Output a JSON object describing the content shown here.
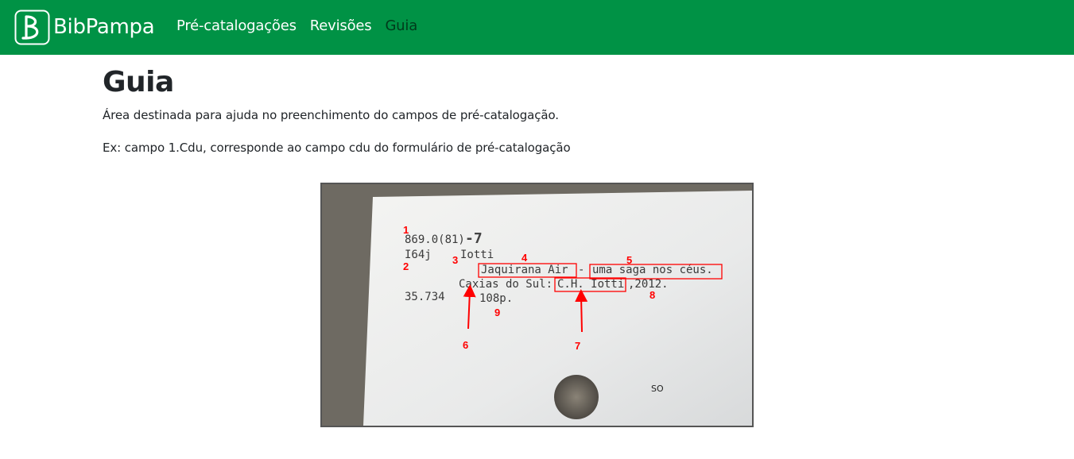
{
  "navbar": {
    "brand": "BibPampa",
    "links": [
      {
        "label": "Pré-catalogações"
      },
      {
        "label": "Revisões"
      },
      {
        "label": "Guia"
      }
    ],
    "colors": {
      "background": "#009245",
      "active_link": "#4d4d4d"
    }
  },
  "page": {
    "title": "Guia",
    "description": "Área destinada para ajuda no preenchimento do campos de pré-catalogação.",
    "example": "Ex: campo 1.Cdu, corresponde ao campo cdu do formulário de pré-catalogação"
  },
  "guide_image": {
    "card_lines": {
      "cdu": "869.0(81)",
      "cdu_suffix": "-7",
      "cutter": "I64j",
      "author": "Iotti",
      "title": "Jaquirana Air",
      "dash": "-",
      "subtitle": "uma saga nos céus.",
      "place": "Caxias do Sul:",
      "publisher": "C.H. Iotti",
      "year": ",2012.",
      "accession": "35.734",
      "pages": "108p.",
      "stamp": "SO"
    },
    "markers": [
      "1",
      "2",
      "3",
      "4",
      "5",
      "6",
      "7",
      "8",
      "9"
    ],
    "marker_color": "#ff0000"
  }
}
